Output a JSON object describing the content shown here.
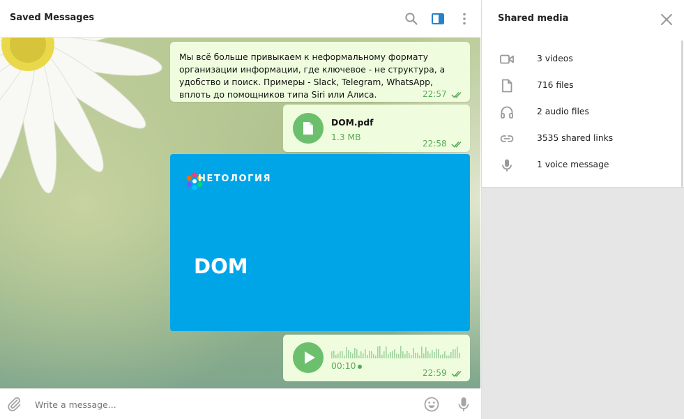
{
  "header": {
    "title": "Saved Messages"
  },
  "messages": {
    "text": {
      "body": "Мы всё больше привыкаем к неформальному формату организации информации, где ключевое - не структура, а удобство и поиск. Примеры - Slack, Telegram, WhatsApp, вплоть до помощников типа Siri или Алиса.",
      "time": "22:57"
    },
    "file": {
      "name": "DOM.pdf",
      "size": "1.3 MB",
      "time": "22:58"
    },
    "photo": {
      "logo_text": "НЕТОЛОГИЯ",
      "title": "DOM"
    },
    "voice": {
      "duration": "00:10",
      "time": "22:59"
    }
  },
  "composer": {
    "placeholder": "Write a message..."
  },
  "side_panel": {
    "title": "Shared media",
    "items": [
      {
        "icon": "video-icon",
        "label": "3 videos"
      },
      {
        "icon": "file-icon",
        "label": "716 files"
      },
      {
        "icon": "headphones-icon",
        "label": "2 audio files"
      },
      {
        "icon": "link-icon",
        "label": "3535 shared links"
      },
      {
        "icon": "microphone-icon",
        "label": "1 voice message"
      }
    ]
  },
  "colors": {
    "accent": "#2481cc",
    "bubble": "#effdde",
    "bubble_meta": "#5aa95a",
    "photo_bg": "#00a5e8"
  }
}
